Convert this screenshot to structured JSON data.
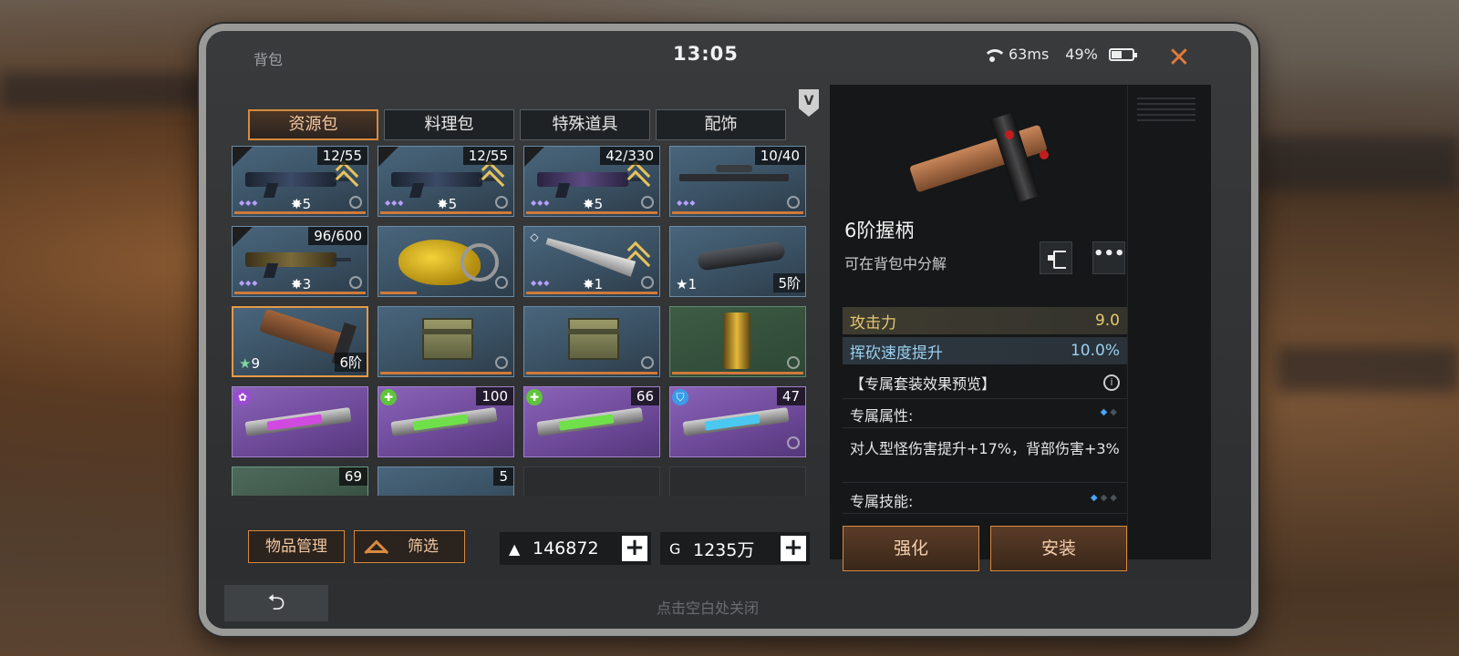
{
  "status": {
    "title": "背包",
    "time": "13:05",
    "ping": "63ms",
    "battery": "49%",
    "close_label": "✕"
  },
  "vip_badge": "V",
  "tabs": [
    {
      "label": "资源包",
      "active": true
    },
    {
      "label": "料理包",
      "active": false
    },
    {
      "label": "特殊道具",
      "active": false
    },
    {
      "label": "配饰",
      "active": false
    }
  ],
  "grid_items": [
    {
      "count": "12/55",
      "level": "5"
    },
    {
      "count": "12/55",
      "level": "5"
    },
    {
      "count": "42/330",
      "level": "5"
    },
    {
      "count": "10/40"
    },
    {
      "count": "96/600",
      "level": "3"
    },
    {},
    {
      "level": "1"
    },
    {
      "star": "1",
      "tier": "5阶"
    },
    {
      "star": "9",
      "tier": "6阶"
    },
    {},
    {},
    {},
    {},
    {
      "count": "100"
    },
    {
      "count": "66"
    },
    {
      "count": "47"
    },
    {
      "count": "69"
    },
    {
      "count": "5"
    },
    {},
    {}
  ],
  "bottom_left": {
    "manage_label": "物品管理",
    "filter_label": "筛选"
  },
  "currency": {
    "gold": "146872",
    "coins": "1235万",
    "plus": "+"
  },
  "detail": {
    "name": "6阶握柄",
    "subtitle": "可在背包中分解",
    "more": "•••",
    "stats": [
      {
        "label": "攻击力",
        "value": "9.0"
      },
      {
        "label": "挥砍速度提升",
        "value": "10.0%"
      }
    ],
    "set_title": "【专属套装效果预览】",
    "info": "i",
    "exclusive_attr_label": "专属属性:",
    "exclusive_attr_desc": "对人型怪伤害提升+17%，背部伤害+3%",
    "exclusive_skill_label": "专属技能:",
    "enhance_label": "强化",
    "install_label": "安装"
  },
  "bottom": {
    "back": "⮌",
    "hint": "点击空白处关闭"
  },
  "colors": {
    "accent": "#d88a3e",
    "attack": "#e8c771",
    "speed": "#9ad0ef"
  }
}
